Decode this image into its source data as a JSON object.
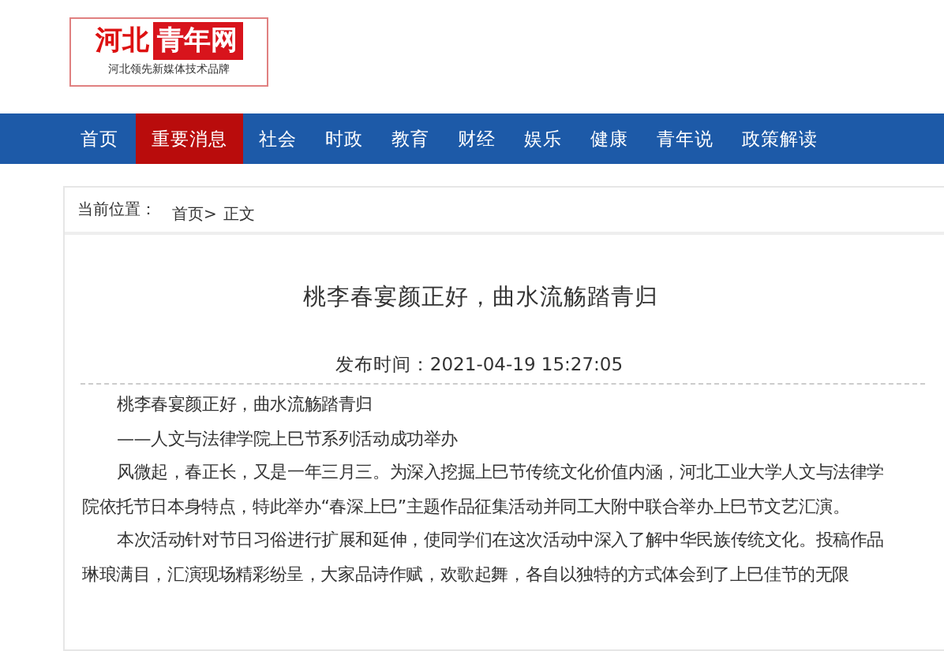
{
  "logo": {
    "name_left": "河北",
    "name_right": "青年网",
    "slogan": "河北领先新媒体技术品牌"
  },
  "nav": [
    {
      "label": "首页",
      "selected": false
    },
    {
      "label": "重要消息",
      "selected": true
    },
    {
      "label": "社会",
      "selected": false
    },
    {
      "label": "时政",
      "selected": false
    },
    {
      "label": "教育",
      "selected": false
    },
    {
      "label": "财经",
      "selected": false
    },
    {
      "label": "娱乐",
      "selected": false
    },
    {
      "label": "健康",
      "selected": false
    },
    {
      "label": "青年说",
      "selected": false
    },
    {
      "label": "政策解读",
      "selected": false
    }
  ],
  "breadcrumb": {
    "label": "当前位置：",
    "items": [
      "首页>",
      "正文"
    ]
  },
  "article": {
    "title": "桃李春宴颜正好，曲水流觞踏青归",
    "publish_time": "发布时间：2021-04-19 15:27:05",
    "paragraphs": [
      "桃李春宴颜正好，曲水流觞踏青归",
      "——人文与法律学院上巳节系列活动成功举办",
      "风微起，春正长，又是一年三月三。为深入挖掘上巳节传统文化价值内涵，河北工业大学人文与法律学院依托节日本身特点，特此举办“春深上巳”主题作品征集活动并同工大附中联合举办上巳节文艺汇演。",
      "本次活动针对节日习俗进行扩展和延伸，使同学们在这次活动中深入了解中华民族传统文化。投稿作品琳琅满目，汇演现场精彩纷呈，大家品诗作赋，欢歌起舞，各自以独特的方式体会到了上巳佳节的无限"
    ]
  }
}
